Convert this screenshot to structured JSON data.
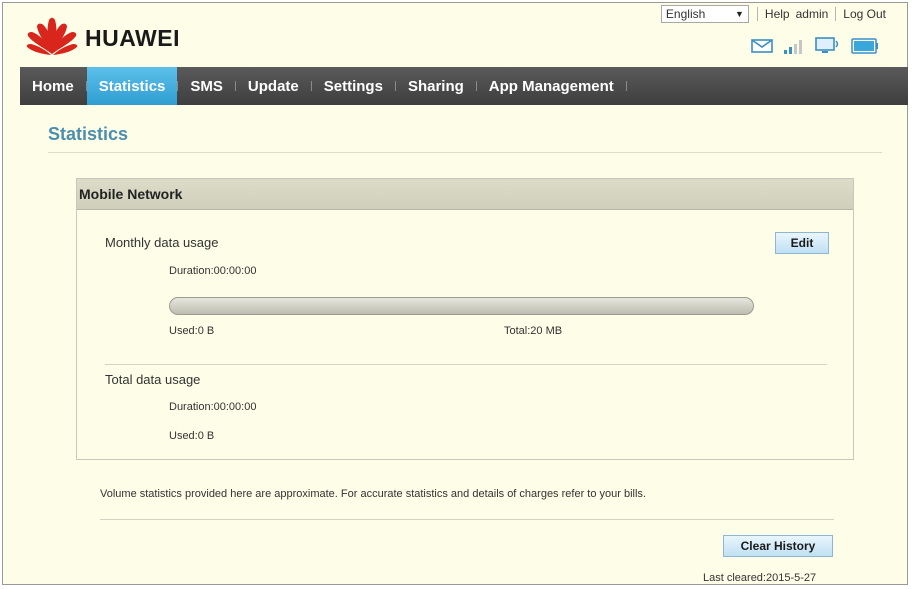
{
  "brand": {
    "name": "HUAWEI",
    "color": "#d9261c"
  },
  "topbar": {
    "language": "English",
    "links": [
      "Help",
      "admin",
      "Log Out"
    ]
  },
  "status_icons": [
    "mail-icon",
    "signal-strength-icon",
    "network-device-icon",
    "battery-icon"
  ],
  "nav": {
    "items": [
      "Home",
      "Statistics",
      "SMS",
      "Update",
      "Settings",
      "Sharing",
      "App Management"
    ],
    "active": "Statistics",
    "accent": "#3aa7da"
  },
  "page": {
    "title": "Statistics"
  },
  "panel": {
    "title": "Mobile Network",
    "monthly": {
      "label": "Monthly data usage",
      "edit_label": "Edit",
      "duration": "Duration:00:00:00",
      "used": "Used:0 B",
      "total": "Total:20 MB",
      "progress": 0
    },
    "total": {
      "label": "Total data usage",
      "duration": "Duration:00:00:00",
      "used": "Used:0 B"
    }
  },
  "note": "Volume statistics provided here are approximate. For accurate statistics and details of charges refer to your bills.",
  "clear_history_label": "Clear History",
  "last_cleared": "Last cleared:2015-5-27"
}
